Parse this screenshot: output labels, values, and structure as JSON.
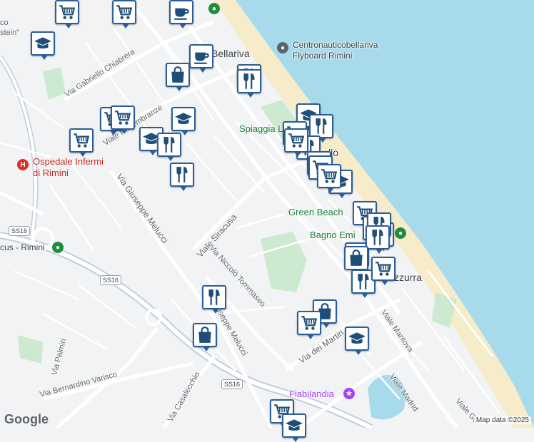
{
  "map": {
    "colors": {
      "sea": "#a7dbec",
      "beach": "#f6ecc9",
      "land": "#f1f3f4",
      "park": "#cde9d0",
      "road": "#ffffff",
      "highway": "#c5cdd8",
      "pin_border": "#2a5d9a",
      "pin_icon": "#1f4e79"
    },
    "street_labels": [
      {
        "key": "chiabrera",
        "text": "Via Gabriello Chiabrera"
      },
      {
        "key": "rimembranze",
        "text": "Viale Rimembranze"
      },
      {
        "key": "melucci",
        "text": "Via Giuseppe Melucci"
      },
      {
        "key": "siracusa",
        "text": "Viale Siracusa"
      },
      {
        "key": "tommaseo",
        "text": "Via Niccolò Tommaseo"
      },
      {
        "key": "melucci2",
        "text": "Via Giuseppe Melucci"
      },
      {
        "key": "palmiri",
        "text": "Via Palmiri"
      },
      {
        "key": "varisco",
        "text": "Via Bernardino Varisco"
      },
      {
        "key": "casalecchio",
        "text": "Via Casalecchio"
      },
      {
        "key": "martiri",
        "text": "Via dei Martiri"
      },
      {
        "key": "mantova",
        "text": "Viale Mantova"
      },
      {
        "key": "madrid",
        "text": "Viale Madrid"
      },
      {
        "key": "gu",
        "text": "Viale Gu"
      }
    ],
    "place_labels": {
      "bellariva": "Bellariva",
      "flyboard": "Centronauticobellariva\nFlyboard Rimini",
      "spiaggia": "Spiaggia L",
      "green_beach": "Green Beach",
      "bagno": "Bagno Emi",
      "azzurra": "zzurra",
      "lo": "llo",
      "ospedale": "Ospedale Infermi\ndi Rimini",
      "circus": "cus - Rimini",
      "fiabilandia": "Fiabilandia",
      "stein": "stein\"",
      "co": "co"
    },
    "shields": [
      "SS16",
      "SS16",
      "SS16",
      "SS16"
    ],
    "attribution": "Map data ©2025",
    "logo": "Google"
  },
  "pins": [
    {
      "type": "cart"
    },
    {
      "type": "coffee"
    },
    {
      "type": "grad"
    },
    {
      "type": "cart"
    },
    {
      "type": "coffee"
    },
    {
      "type": "bag"
    },
    {
      "type": "fork"
    },
    {
      "type": "fork"
    },
    {
      "type": "cart"
    },
    {
      "type": "cart"
    },
    {
      "type": "grad"
    },
    {
      "type": "cart"
    },
    {
      "type": "grad"
    },
    {
      "type": "fork"
    },
    {
      "type": "fork"
    },
    {
      "type": "grad"
    },
    {
      "type": "fork"
    },
    {
      "type": "cart"
    },
    {
      "type": "fork"
    },
    {
      "type": "cart"
    },
    {
      "type": "cart"
    },
    {
      "type": "grad"
    },
    {
      "type": "cart"
    },
    {
      "type": "cart"
    },
    {
      "type": "bag"
    },
    {
      "type": "bag"
    },
    {
      "type": "cart"
    },
    {
      "type": "cart"
    },
    {
      "type": "fork"
    },
    {
      "type": "fork"
    },
    {
      "type": "bag"
    },
    {
      "type": "fork"
    },
    {
      "type": "bag"
    },
    {
      "type": "cart"
    },
    {
      "type": "cart"
    },
    {
      "type": "grad"
    },
    {
      "type": "cart"
    },
    {
      "type": "grad"
    },
    {
      "type": "bag"
    },
    {
      "type": "fork"
    }
  ]
}
